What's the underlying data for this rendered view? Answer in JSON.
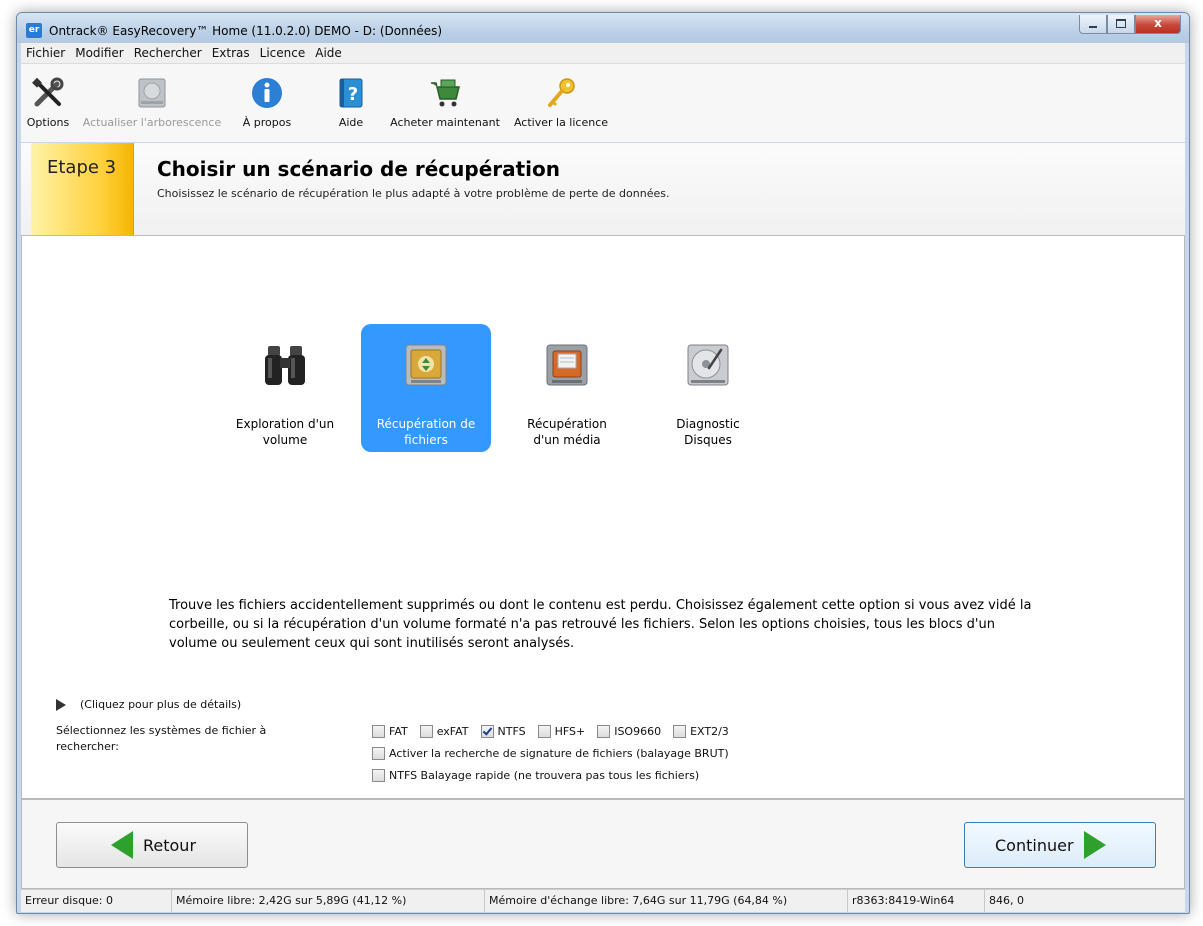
{
  "window": {
    "app_icon": "er",
    "title": "Ontrack® EasyRecovery™ Home (11.0.2.0) DEMO - D: (Données)",
    "close_glyph": "x"
  },
  "menu": [
    "Fichier",
    "Modifier",
    "Rechercher",
    "Extras",
    "Licence",
    "Aide"
  ],
  "toolbar": {
    "options": "Options",
    "refresh_tree": "Actualiser l'arborescence",
    "about": "À propos",
    "help": "Aide",
    "buy": "Acheter maintenant",
    "activate": "Activer la licence"
  },
  "step": {
    "label": "Etape 3",
    "title": "Choisir un scénario de récupération",
    "subtitle": "Choisissez le scénario de récupération le plus adapté à votre problème de perte de données."
  },
  "scenarios": [
    {
      "line1": "Exploration d'un",
      "line2": "volume",
      "icon": "binoculars-icon"
    },
    {
      "line1": "Récupération de",
      "line2": "fichiers",
      "icon": "file-recovery-icon",
      "selected": true
    },
    {
      "line1": "Récupération",
      "line2": "d'un média",
      "icon": "media-recovery-icon"
    },
    {
      "line1": "Diagnostic",
      "line2": "Disques",
      "icon": "hard-disk-icon"
    }
  ],
  "description": "Trouve les fichiers accidentellement supprimés ou dont le contenu est perdu. Choisissez également cette option si vous avez vidé la corbeille, ou si la récupération d'un volume formaté n'a pas retrouvé les fichiers. Selon les options choisies, tous les blocs d'un volume ou seulement ceux qui sont inutilisés seront analysés.",
  "details_toggle": "(Cliquez pour plus de détails)",
  "filesystems": {
    "label": "Sélectionnez les systèmes de fichier à rechercher:",
    "options": [
      {
        "label": "FAT",
        "checked": false
      },
      {
        "label": "exFAT",
        "checked": false
      },
      {
        "label": "NTFS",
        "checked": true
      },
      {
        "label": "HFS+",
        "checked": false
      },
      {
        "label": "ISO9660",
        "checked": false
      },
      {
        "label": "EXT2/3",
        "checked": false
      }
    ],
    "raw_scan": {
      "label": "Activer la recherche de signature de fichiers (balayage BRUT)",
      "checked": false
    },
    "ntfs_quick": {
      "label": "NTFS Balayage rapide (ne trouvera pas tous les fichiers)",
      "checked": false
    }
  },
  "buttons": {
    "back": "Retour",
    "continue": "Continuer"
  },
  "status": {
    "disk_error": "Erreur disque: 0",
    "free_memory": "Mémoire libre: 2,42G sur 5,89G (41,12 %)",
    "free_swap": "Mémoire d'échange libre: 7,64G sur 11,79G (64,84 %)",
    "build": "r8363:8419-Win64",
    "coords": "846, 0"
  },
  "colors": {
    "selection": "#3399ff",
    "step_accent": "#ffd03a",
    "arrow": "#2ea02e"
  }
}
